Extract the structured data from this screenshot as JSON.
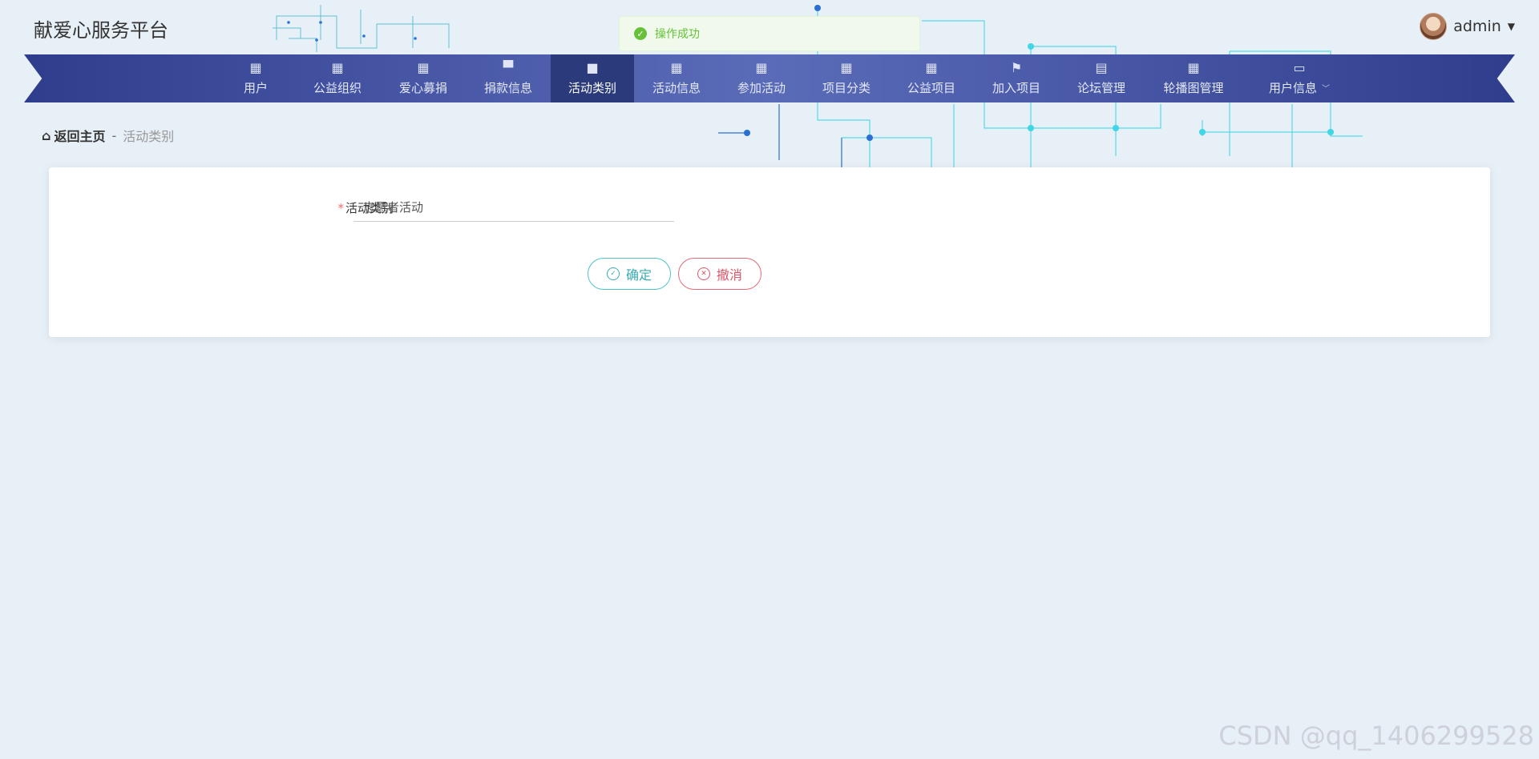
{
  "header": {
    "site_title": "献爱心服务平台",
    "username": "admin"
  },
  "toast": {
    "message": "操作成功",
    "color": "#67c23a"
  },
  "nav": {
    "items": [
      {
        "label": "用户",
        "icon": "grid-icon"
      },
      {
        "label": "公益组织",
        "icon": "grid-icon"
      },
      {
        "label": "爱心募捐",
        "icon": "grid-icon"
      },
      {
        "label": "捐款信息",
        "icon": "desktop-icon"
      },
      {
        "label": "活动类别",
        "icon": "briefcase-icon",
        "active": true
      },
      {
        "label": "活动信息",
        "icon": "grid-icon"
      },
      {
        "label": "参加活动",
        "icon": "grid-icon"
      },
      {
        "label": "项目分类",
        "icon": "grid-icon"
      },
      {
        "label": "公益项目",
        "icon": "grid-icon"
      },
      {
        "label": "加入项目",
        "icon": "flag-icon"
      },
      {
        "label": "论坛管理",
        "icon": "clipboard-icon"
      },
      {
        "label": "轮播图管理",
        "icon": "grid-icon"
      },
      {
        "label": "用户信息",
        "icon": "wallet-icon"
      }
    ]
  },
  "breadcrumb": {
    "home": "返回主页",
    "separator": "-",
    "current": "活动类别"
  },
  "form": {
    "required_mark": "*",
    "field_label": "活动类别",
    "field_value": "志愿者活动",
    "confirm_label": "确定",
    "cancel_label": "撤消"
  },
  "watermark": "CSDN @qq_1406299528",
  "colors": {
    "nav_bg": "#3a4a98",
    "nav_active": "#2a3a7a",
    "confirm": "#3aabb2",
    "cancel": "#d9566a",
    "required": "#f56c6c"
  }
}
